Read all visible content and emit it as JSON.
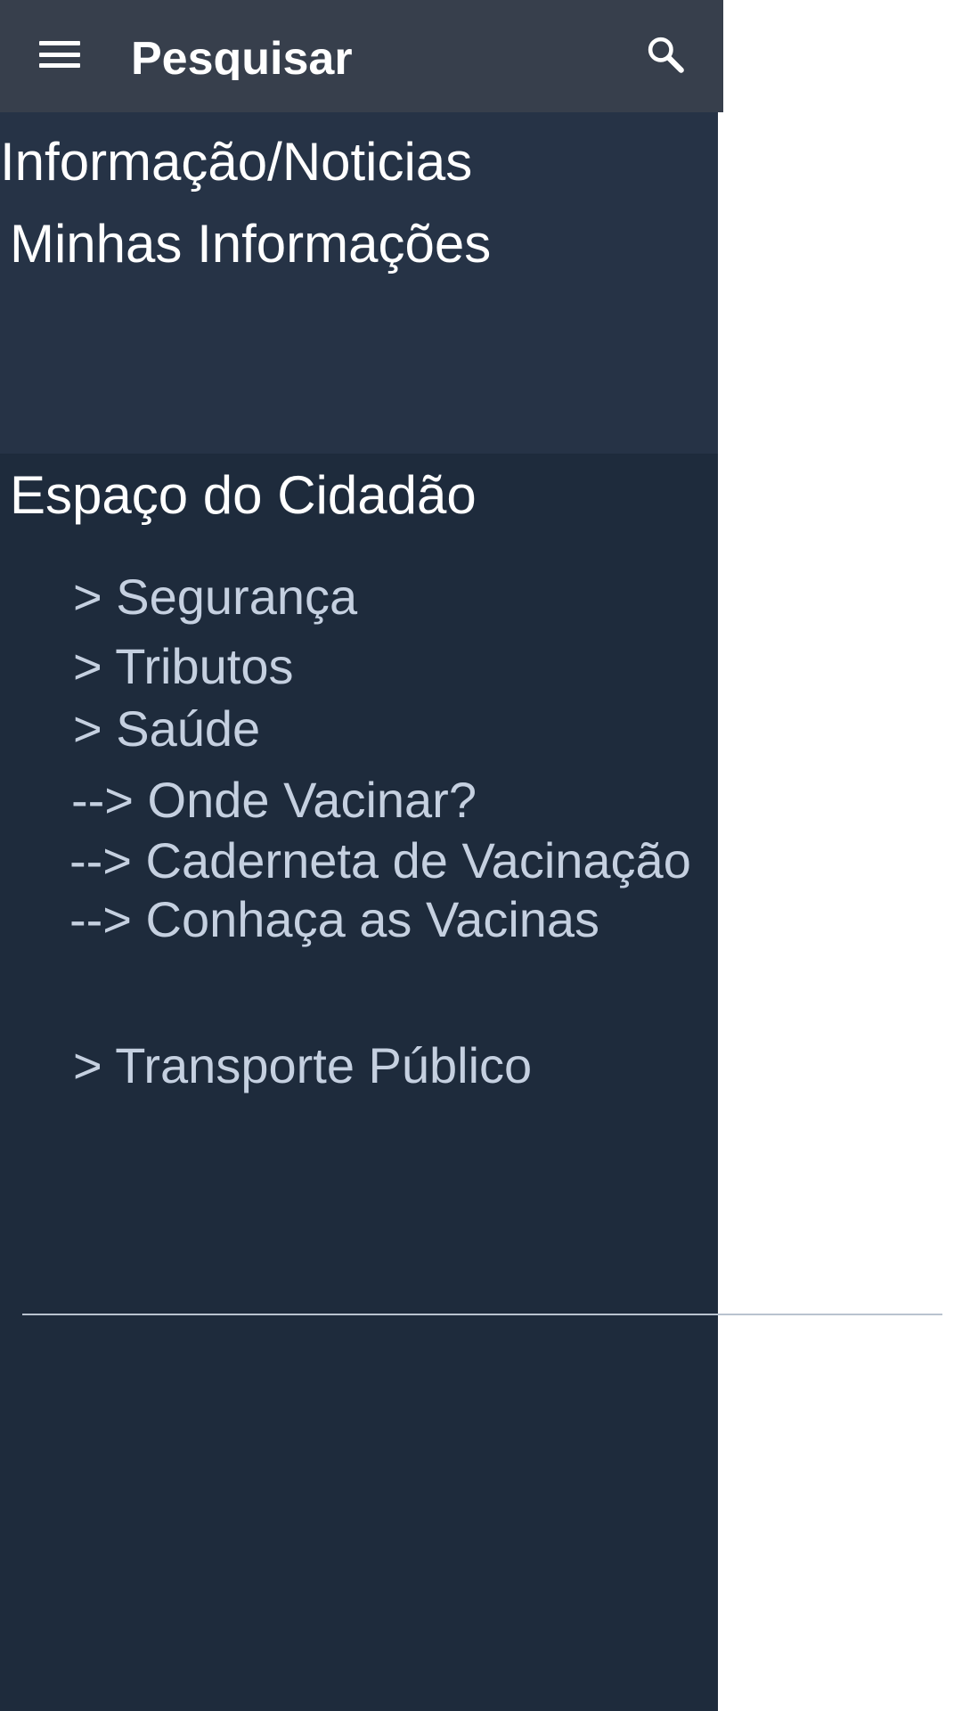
{
  "toolbar": {
    "menu_icon": "hamburger-menu-icon",
    "title": "Pesquisar",
    "search_icon": "search-icon"
  },
  "drawer": {
    "header_items": [
      {
        "label": "Informação/Noticias"
      },
      {
        "label": "Minhas Informações"
      }
    ],
    "section": {
      "title": "Espaço do Cidadão",
      "items": [
        {
          "label": "> Segurança"
        },
        {
          "label": "> Tributos"
        },
        {
          "label": "> Saúde"
        },
        {
          "label": "--> Onde Vacinar?"
        },
        {
          "label": "--> Caderneta de Vacinação"
        },
        {
          "label": "--> Conhaça as Vacinas"
        },
        {
          "label": "> Transporte Público"
        }
      ]
    }
  },
  "colors": {
    "toolbar_bg": "#373f4c",
    "drawer_top_bg": "#263346",
    "drawer_bg": "#1e2b3c",
    "primary_text": "#ffffff",
    "secondary_text": "#c5d0e0",
    "content_bg": "#ffffff"
  }
}
